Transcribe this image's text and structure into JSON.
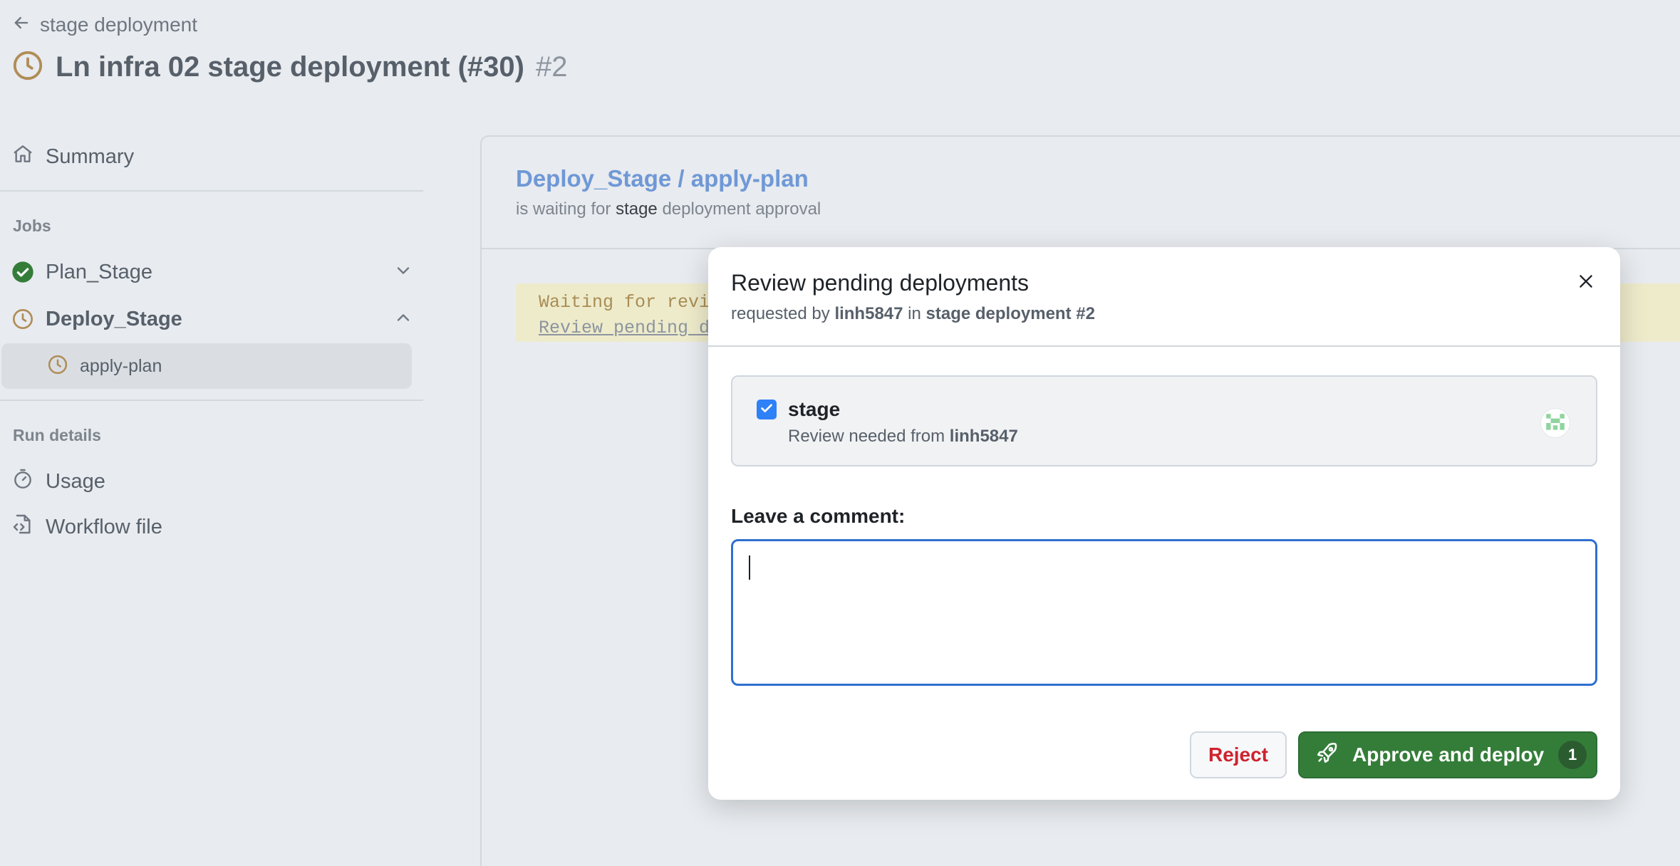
{
  "header": {
    "back_label": "stage deployment",
    "run_title": "Ln infra 02 stage deployment (#30)",
    "run_number": "#2"
  },
  "sidebar": {
    "summary_label": "Summary",
    "jobs_heading": "Jobs",
    "jobs": [
      {
        "label": "Plan_Stage",
        "status": "success",
        "expanded": false
      },
      {
        "label": "Deploy_Stage",
        "status": "waiting",
        "expanded": true
      }
    ],
    "sub_job": {
      "label": "apply-plan",
      "status": "waiting"
    },
    "run_details_heading": "Run details",
    "usage_label": "Usage",
    "workflow_file_label": "Workflow file"
  },
  "main": {
    "job_title": "Deploy_Stage / apply-plan",
    "status_prefix": "is waiting for",
    "status_env": "stage",
    "status_suffix": "deployment approval",
    "waiting_line_1": "Waiting for revie",
    "waiting_line_2": "Review pending de"
  },
  "modal": {
    "title": "Review pending deployments",
    "subtitle_prefix": "requested by",
    "requester": "linh5847",
    "subtitle_in": "in",
    "workflow_ref": "stage deployment #2",
    "environment": {
      "name": "stage",
      "checked": true,
      "review_prefix": "Review needed from",
      "reviewer": "linh5847"
    },
    "comment_label": "Leave a comment:",
    "comment_value": "",
    "reject_label": "Reject",
    "approve_label": "Approve and deploy",
    "approve_count": "1"
  },
  "colors": {
    "page_bg": "#e8ebef",
    "waiting_clock": "#b08d57",
    "success_green": "#347d39",
    "link_blue": "#6f98d6",
    "reject_red": "#cf222e",
    "approve_green": "#347d39",
    "checkbox_blue": "#2f81f7",
    "focus_border": "#2f6fd0"
  },
  "icons": {
    "back": "arrow-left-icon",
    "run_status": "clock-icon",
    "summary": "home-icon",
    "success": "check-circle-icon",
    "chevron_down": "chevron-down-icon",
    "chevron_up": "chevron-up-icon",
    "usage": "stopwatch-icon",
    "workflow_file": "file-code-icon",
    "close": "x-icon",
    "avatar": "identicon-avatar",
    "approve": "rocket-icon"
  }
}
